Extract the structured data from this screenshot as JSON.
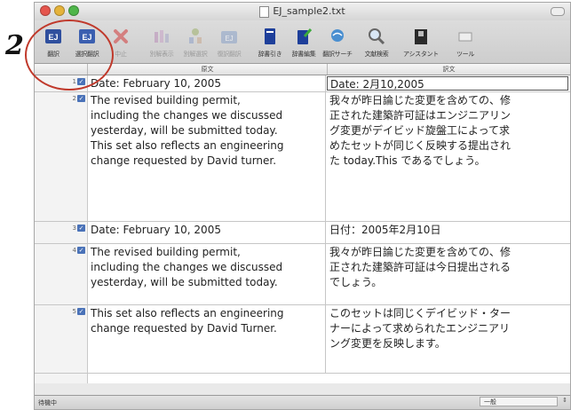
{
  "overlay": {
    "step_number": "2"
  },
  "window": {
    "title": "EJ_sample2.txt"
  },
  "toolbar": {
    "items": [
      {
        "label": "翻訳",
        "icon": "translate-icon",
        "enabled": true
      },
      {
        "label": "選択翻訳",
        "icon": "selection-translate-icon",
        "enabled": true
      },
      {
        "label": "中止",
        "icon": "stop-icon",
        "enabled": false
      },
      {
        "label": "別解表示",
        "icon": "alternative-translation-icon",
        "enabled": false
      },
      {
        "label": "別解選択",
        "icon": "alternative-select-icon",
        "enabled": false
      },
      {
        "label": "復訳翻訳",
        "icon": "retranslate-icon",
        "enabled": false
      },
      {
        "label": "辞書引き",
        "icon": "dictionary-lookup-icon",
        "enabled": true
      },
      {
        "label": "辞書編集",
        "icon": "dictionary-edit-icon",
        "enabled": true
      },
      {
        "label": "翻訳サーチ",
        "icon": "translation-search-icon",
        "enabled": true
      },
      {
        "label": "文献検索",
        "icon": "document-search-icon",
        "enabled": true
      },
      {
        "label": "アシスタント",
        "icon": "assistant-icon",
        "enabled": true
      },
      {
        "label": "ツール",
        "icon": "tool-icon",
        "enabled": true
      }
    ]
  },
  "columns": {
    "source": "原文",
    "target": "訳文"
  },
  "rows": [
    {
      "num": "1",
      "source": [
        "Date: February 10, 2005"
      ],
      "target": [
        "Date: 2月10,2005"
      ],
      "highlight": true
    },
    {
      "num": "2",
      "source": [
        "The revised building permit,",
        "including the changes we discussed",
        "yesterday, will be submitted today.",
        "This set also reflects an engineering",
        "change requested by David turner."
      ],
      "target": [
        "我々が昨日論じた変更を含めての、修",
        "正された建築許可証はエンジニアリン",
        "グ変更がデイビッド旋盤工によって求",
        "めたセットが同じく反映する提出され",
        "た today.This であるでしょう。"
      ],
      "highlight": false
    },
    {
      "num": "3",
      "source": [
        "Date: February 10, 2005"
      ],
      "target": [
        "日付：2005年2月10日"
      ],
      "highlight": false
    },
    {
      "num": "4",
      "source": [
        "The revised building permit,",
        "including the changes we discussed",
        "yesterday, will be submitted today."
      ],
      "target": [
        "我々が昨日論じた変更を含めての、修",
        "正された建築許可証は今日提出される",
        "でしょう。"
      ],
      "highlight": false
    },
    {
      "num": "5",
      "source": [
        "This set also reflects an engineering",
        "change requested by David Turner."
      ],
      "target": [
        "このセットは同じくデイビッド・ター",
        "ナーによって求められたエンジニアリ",
        "ング変更を反映します。"
      ],
      "highlight": false
    }
  ],
  "status": {
    "text": "待機中",
    "select_value": "一般",
    "arrows": "⇕"
  }
}
